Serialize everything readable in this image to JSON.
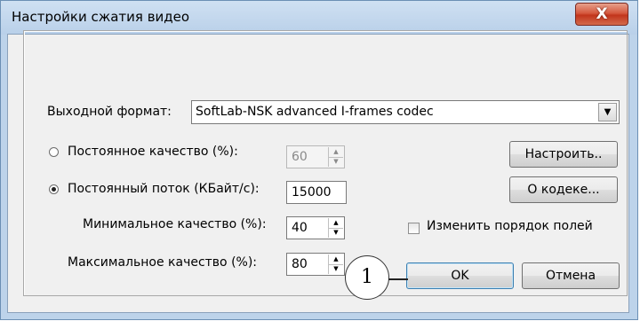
{
  "window": {
    "title": "Настройки сжатия видео",
    "close_glyph": "X"
  },
  "output_format": {
    "label": "Выходной формат:",
    "value": "SoftLab-NSK advanced I-frames codec",
    "arrow": "▼"
  },
  "constant_quality": {
    "label": "Постоянное качество (%):",
    "value": "60",
    "selected": false
  },
  "constant_bitrate": {
    "label": "Постоянный поток (КБайт/с):",
    "value": "15000",
    "selected": true
  },
  "min_quality": {
    "label": "Минимальное качество (%):",
    "value": "40"
  },
  "max_quality": {
    "label": "Максимальное качество (%):",
    "value": "80"
  },
  "buttons": {
    "configure": "Настроить..",
    "about": "О кодеке...",
    "ok": "OK",
    "cancel": "Отмена"
  },
  "reorder_fields": {
    "label": "Изменить порядок полей",
    "checked": false
  },
  "callout": {
    "number": "1"
  },
  "spin_arrows": {
    "up": "▲",
    "down": "▼"
  },
  "colors": {
    "title_bar": "#bdd3ea",
    "close_button": "#c8452a",
    "dialog_bg": "#f0f0f0"
  }
}
